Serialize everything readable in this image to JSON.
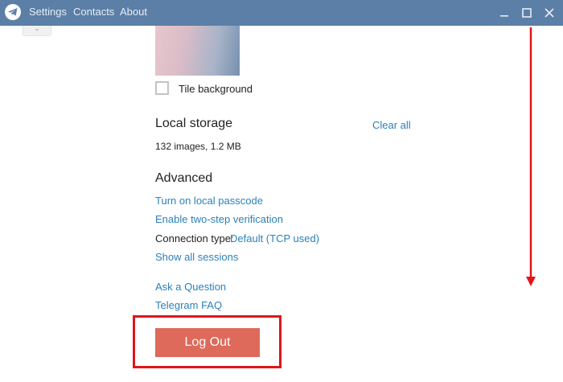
{
  "titlebar": {
    "menu": [
      "Settings",
      "Contacts",
      "About"
    ],
    "controls": [
      "minimize-icon",
      "maximize-icon",
      "close-icon"
    ],
    "color": "#5b7fa6"
  },
  "background": {
    "tile_label": "Tile background"
  },
  "local_storage": {
    "heading": "Local storage",
    "clear_all": "Clear all",
    "info": "132 images, 1.2 MB"
  },
  "advanced": {
    "heading": "Advanced",
    "passcode_link": "Turn on local passcode",
    "two_step_link": "Enable two-step verification",
    "connection_label": "Connection type:",
    "connection_value": "Default (TCP used)",
    "sessions_link": "Show all sessions"
  },
  "help": {
    "ask_question": "Ask a Question",
    "faq": "Telegram FAQ"
  },
  "logout": {
    "label": "Log Out",
    "color": "#dd6a5a"
  },
  "annotation_color": "#e0151b"
}
